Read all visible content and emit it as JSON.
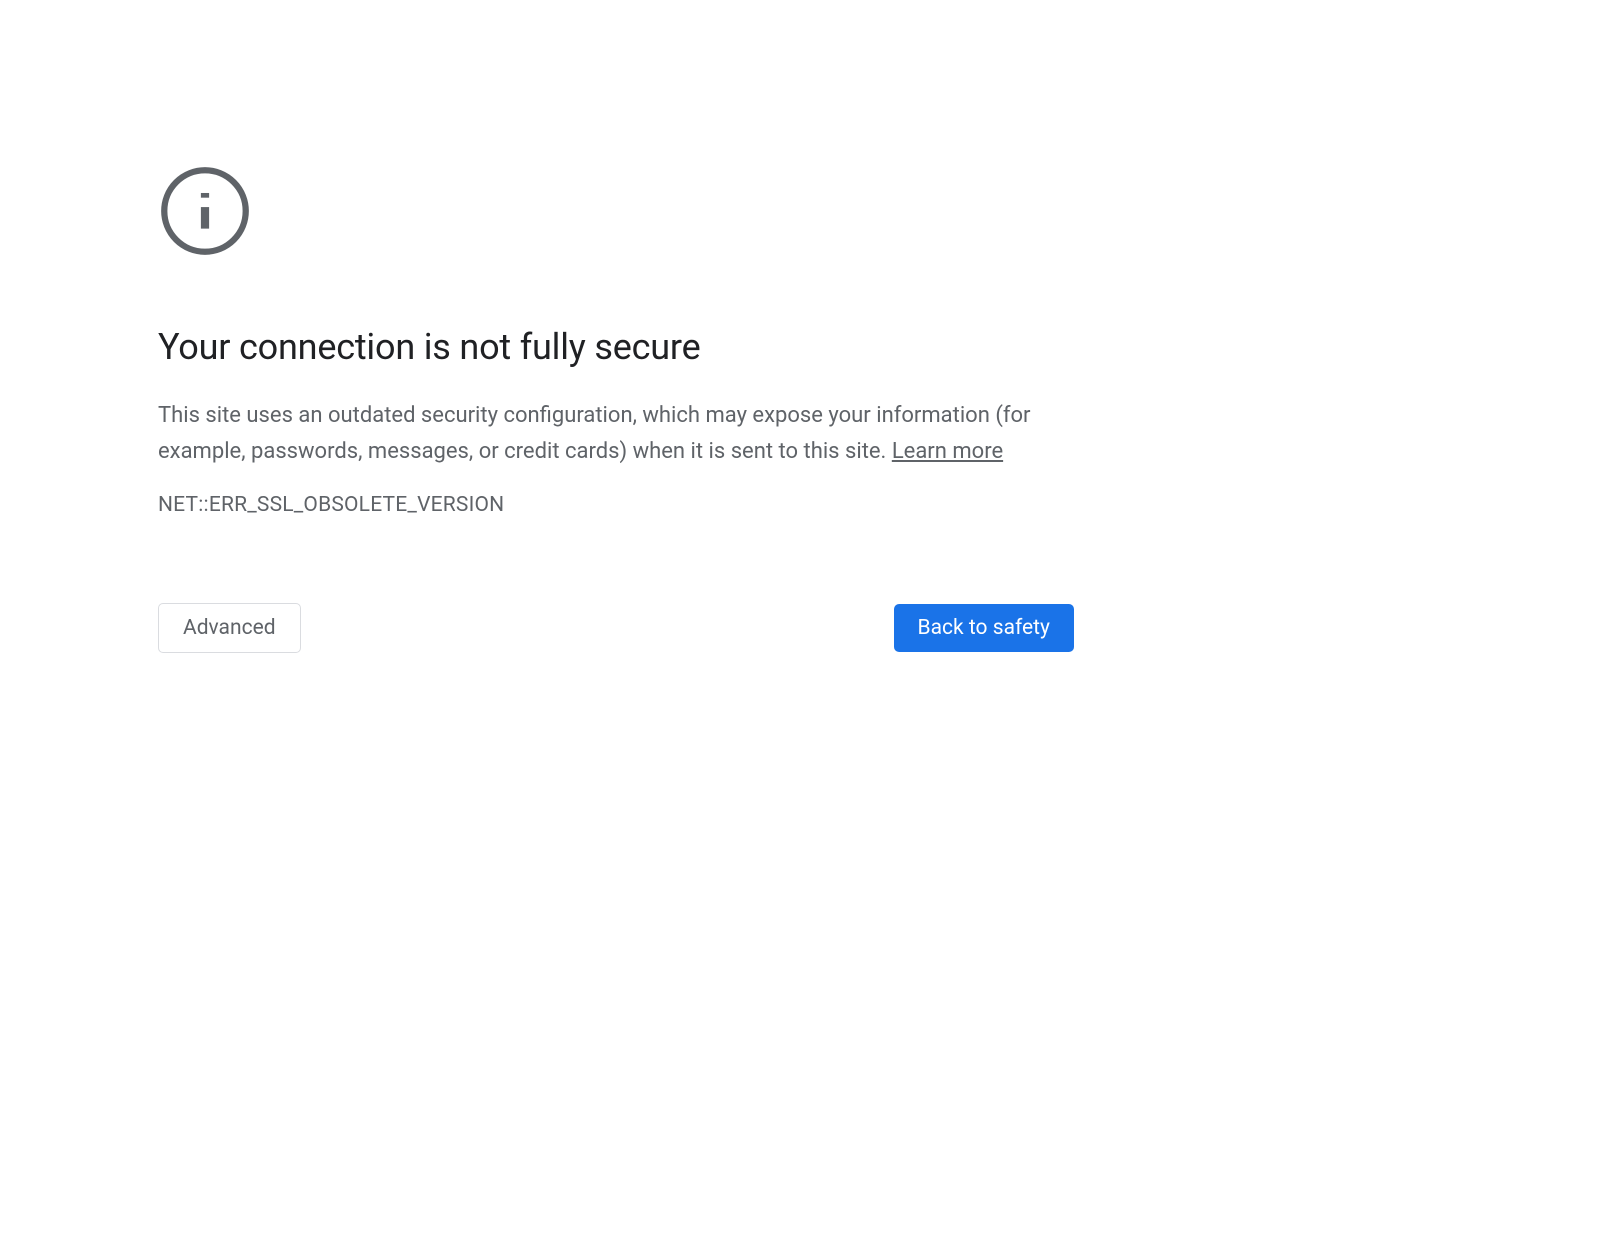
{
  "title": "Your connection is not fully secure",
  "description_text": "This site uses an outdated security configuration, which may expose your information (for example, passwords, messages, or credit cards) when it is sent to this site. ",
  "learn_more_label": "Learn more",
  "error_code": "NET::ERR_SSL_OBSOLETE_VERSION",
  "buttons": {
    "advanced": "Advanced",
    "back_to_safety": "Back to safety"
  }
}
